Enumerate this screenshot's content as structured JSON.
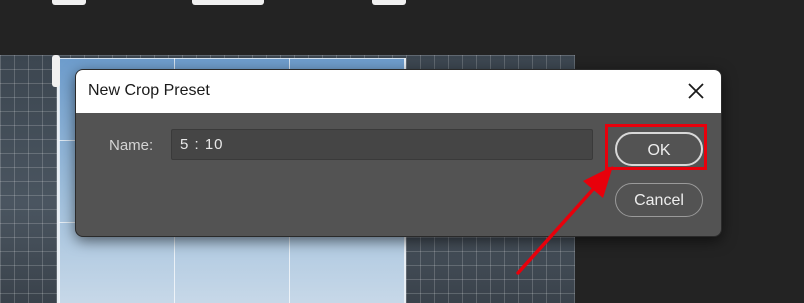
{
  "dialog": {
    "title": "New Crop Preset",
    "name_label": "Name:",
    "name_value": "5 : 10",
    "ok_label": "OK",
    "cancel_label": "Cancel",
    "close_icon": "close-icon"
  },
  "annotation": {
    "color": "#e8000b",
    "target": "ok-button"
  },
  "colors": {
    "app_background": "#232323",
    "dialog_background": "#535353",
    "titlebar_background": "#ffffff",
    "input_background": "#454545"
  }
}
